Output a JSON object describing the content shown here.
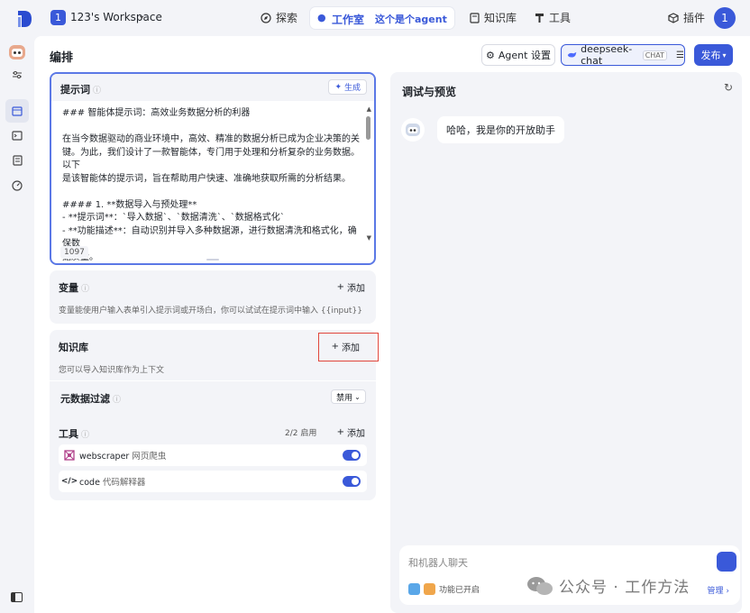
{
  "topbar": {
    "workspace_badge": "1",
    "workspace_name": "123's Workspace",
    "nav": {
      "explore": "探索",
      "studio": "工作室",
      "agent_name": "这个是个agent",
      "knowledge": "知识库",
      "tools": "工具",
      "plugins": "插件"
    },
    "avatar": "1"
  },
  "header": {
    "title": "编排",
    "agent_settings": "Agent 设置",
    "model_name": "deepseek-chat",
    "model_tag": "CHAT",
    "publish": "发布"
  },
  "prompt": {
    "label": "提示词",
    "generate": "生成",
    "lines": [
      "### 智能体提示词：高效业务数据分析的利器",
      "",
      "在当今数据驱动的商业环境中，高效、精准的数据分析已成为企业决策的关",
      "键。为此，我们设计了一款智能体，专门用于处理和分析复杂的业务数据。以下",
      "是该智能体的提示词，旨在帮助用户快速、准确地获取所需的分析结果。",
      "",
      "#### 1. **数据导入与预处理**",
      "- **提示词**：`导入数据`、`数据清洗`、`数据格式化`",
      "- **功能描述**：自动识别并导入多种数据源，进行数据清洗和格式化，确保数",
      "据质量。"
    ],
    "char_count": "1097"
  },
  "variables": {
    "label": "变量",
    "add": "添加",
    "desc": "变量能使用户输入表单引入提示词或开场白，你可以试试在提示词中输入 {{input}}"
  },
  "knowledge": {
    "label": "知识库",
    "add": "添加",
    "desc": "您可以导入知识库作为上下文",
    "meta_filter_label": "元数据过滤",
    "meta_filter_value": "禁用"
  },
  "tools": {
    "label": "工具",
    "count": "2/2 启用",
    "add": "添加",
    "items": [
      {
        "name": "webscraper",
        "desc": "网页爬虫",
        "icon": "spider-icon"
      },
      {
        "name": "code",
        "desc": "代码解释器",
        "icon": "code-icon"
      }
    ]
  },
  "preview": {
    "title": "调试与预览",
    "greeting": "哈哈，我是你的开放助手",
    "input_placeholder": "和机器人聊天",
    "feature_status": "功能已开启",
    "manage": "管理"
  },
  "watermark": "公众号 · 工作方法",
  "colors": {
    "accent": "#3a59d9",
    "highlight_box": "#e1463c"
  }
}
